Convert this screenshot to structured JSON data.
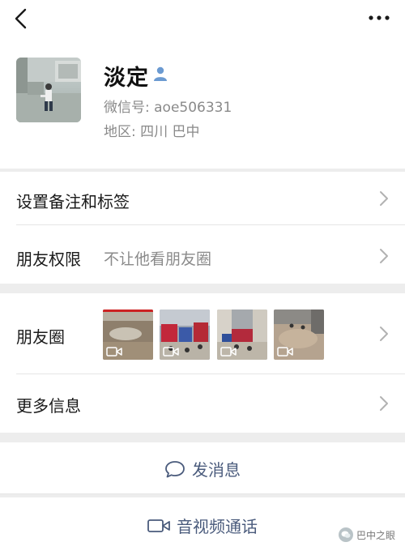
{
  "profile": {
    "nickname": "淡定",
    "wechat_id": "微信号: aoe506331",
    "region": "地区: 四川  巴中"
  },
  "rows": {
    "remark_label": "设置备注和标签",
    "permission_label": "朋友权限",
    "permission_value": "不让他看朋友圈",
    "moments_label": "朋友圈",
    "more_info_label": "更多信息"
  },
  "moments_thumbs": [
    {
      "icon": "video-camera-icon",
      "kind": "video"
    },
    {
      "icon": "video-camera-icon",
      "kind": "video"
    },
    {
      "icon": "video-camera-icon",
      "kind": "video"
    },
    {
      "icon": "video-camera-icon",
      "kind": "video"
    }
  ],
  "actions": {
    "message_label": "发消息",
    "call_label": "音视频通话"
  },
  "watermark": {
    "text": "巴中之眼"
  },
  "colors": {
    "action_text": "#4a5b7c",
    "secondary_text": "#8a8a8a",
    "background": "#ededed"
  }
}
